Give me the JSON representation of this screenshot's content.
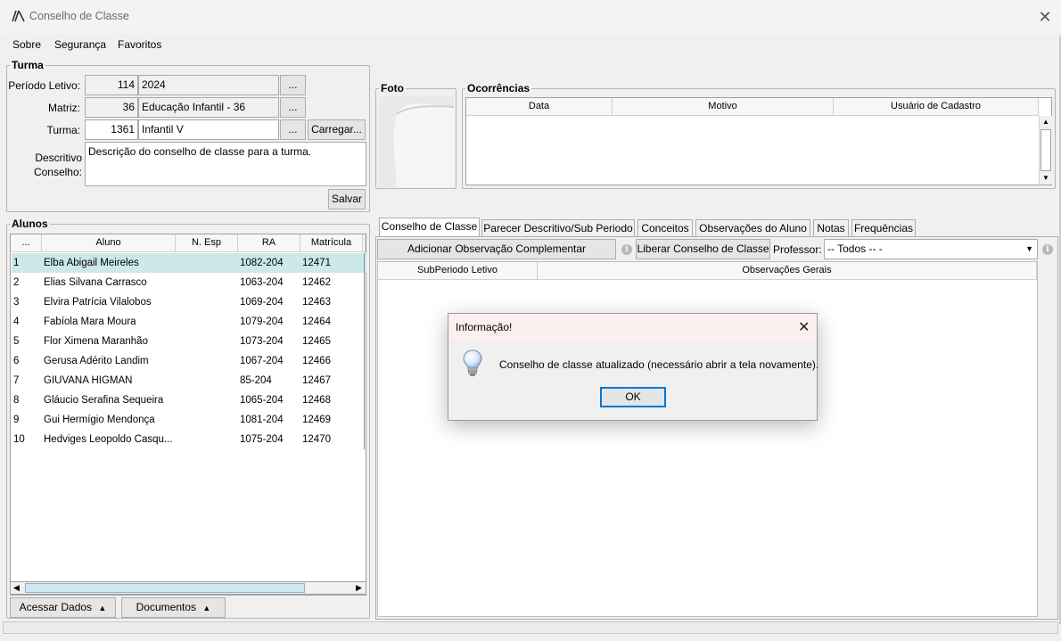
{
  "window": {
    "title": "Conselho de Classe"
  },
  "menu": [
    "Sobre",
    "Segurança",
    "Favoritos"
  ],
  "turma": {
    "group_title": "Turma",
    "periodo_label": "Período Letivo:",
    "periodo_code": "114",
    "periodo_value": "2024",
    "matriz_label": "Matriz:",
    "matriz_code": "36",
    "matriz_value": "Educação Infantil - 36",
    "turma_label": "Turma:",
    "turma_code": "1361",
    "turma_value": "Infantil V",
    "ellipsis": "...",
    "carregar": "Carregar...",
    "descritivo_label_1": "Descritivo",
    "descritivo_label_2": "Conselho:",
    "descritivo_value": "Descrição do conselho de classe para a turma.",
    "salvar": "Salvar"
  },
  "alunos": {
    "group_title": "Alunos",
    "columns": [
      "...",
      "Aluno",
      "N. Esp",
      "RA",
      "Matrícula"
    ],
    "rows": [
      {
        "n": "1",
        "nome": "Elba Abigail Meireles",
        "esp": "",
        "ra": "1082-204",
        "mat": "12471"
      },
      {
        "n": "2",
        "nome": "Elias Silvana Carrasco",
        "esp": "",
        "ra": "1063-204",
        "mat": "12462"
      },
      {
        "n": "3",
        "nome": "Elvira Patrícia Vilalobos",
        "esp": "",
        "ra": "1069-204",
        "mat": "12463"
      },
      {
        "n": "4",
        "nome": "Fabíola Mara Moura",
        "esp": "",
        "ra": "1079-204",
        "mat": "12464"
      },
      {
        "n": "5",
        "nome": "Flor Ximena Maranhão",
        "esp": "",
        "ra": "1073-204",
        "mat": "12465"
      },
      {
        "n": "6",
        "nome": "Gerusa Adérito Landim",
        "esp": "",
        "ra": "1067-204",
        "mat": "12466"
      },
      {
        "n": "7",
        "nome": "GIUVANA HIGMAN",
        "esp": "",
        "ra": "85-204",
        "mat": "12467"
      },
      {
        "n": "8",
        "nome": "Gláucio Serafina Sequeira",
        "esp": "",
        "ra": "1065-204",
        "mat": "12468"
      },
      {
        "n": "9",
        "nome": "Gui Hermígio Mendonça",
        "esp": "",
        "ra": "1081-204",
        "mat": "12469"
      },
      {
        "n": "10",
        "nome": "Hedviges Leopoldo Casqu...",
        "esp": "",
        "ra": "1075-204",
        "mat": "12470"
      }
    ],
    "acessar": "Acessar Dados",
    "documentos": "Documentos"
  },
  "foto": {
    "group_title": "Foto"
  },
  "ocorrencias": {
    "group_title": "Ocorrências",
    "columns": [
      "Data",
      "Motivo",
      "Usuário de Cadastro"
    ]
  },
  "tabs": [
    "Conselho de Classe",
    "Parecer Descritivo/Sub Periodo",
    "Conceitos",
    "Observações do Aluno",
    "Notas",
    "Frequências"
  ],
  "conselho": {
    "add_obs": "Adicionar Observação Complementar",
    "liberar": "Liberar Conselho de Classe",
    "professor_label": "Professor:",
    "professor_value": "-- Todos -- -",
    "columns": [
      "SubPeriodo Letivo",
      "Observações Gerais"
    ]
  },
  "dialog": {
    "title": "Informação!",
    "message": "Conselho de classe atualizado (necessário abrir a tela novamente).",
    "ok": "OK"
  }
}
